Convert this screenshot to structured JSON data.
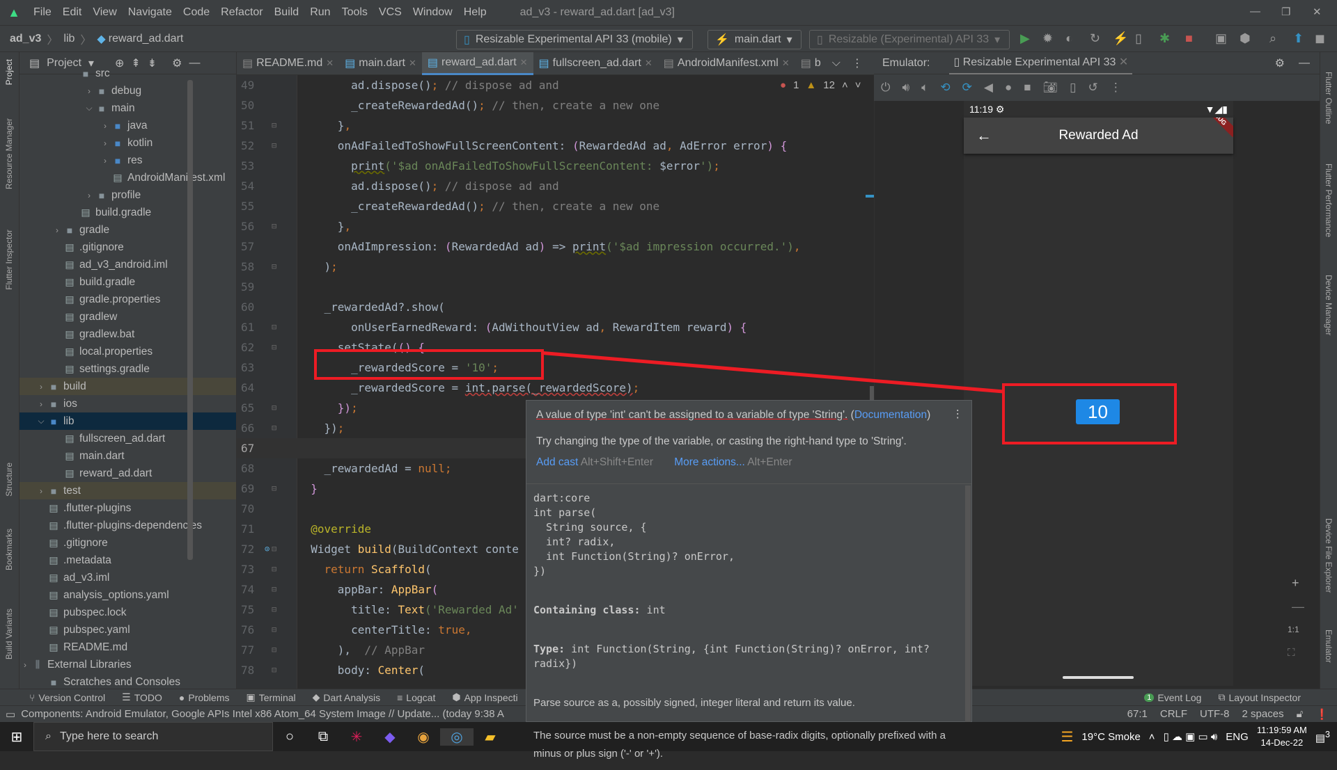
{
  "window": {
    "title": "ad_v3 - reward_ad.dart [ad_v3]",
    "menu": [
      "File",
      "Edit",
      "View",
      "Navigate",
      "Code",
      "Refactor",
      "Build",
      "Run",
      "Tools",
      "VCS",
      "Window",
      "Help"
    ]
  },
  "nav": {
    "breadcrumb": [
      "ad_v3",
      "lib",
      "reward_ad.dart"
    ],
    "device_combo": "Resizable Experimental API 33 (mobile)",
    "run_config": "main.dart",
    "target_combo": "Resizable (Experimental) API 33"
  },
  "left_strip": [
    "Project",
    "Resource Manager",
    "Flutter Inspector",
    "Structure",
    "Bookmarks",
    "Build Variants"
  ],
  "right_strip": [
    "Flutter Outline",
    "Flutter Performance",
    "Device Manager",
    "Device File Explorer",
    "Emulator"
  ],
  "project": {
    "title": "Project",
    "tree": [
      {
        "label": "src",
        "level": 3,
        "kind": "folder",
        "arrow": ""
      },
      {
        "label": "debug",
        "level": 4,
        "kind": "folder",
        "arrow": "collapsed"
      },
      {
        "label": "main",
        "level": 4,
        "kind": "folder",
        "arrow": "expanded"
      },
      {
        "label": "java",
        "level": 5,
        "kind": "folder",
        "arrow": "collapsed"
      },
      {
        "label": "kotlin",
        "level": 5,
        "kind": "folder",
        "arrow": "collapsed"
      },
      {
        "label": "res",
        "level": 5,
        "kind": "folder",
        "arrow": "collapsed"
      },
      {
        "label": "AndroidManifest.xml",
        "level": 5,
        "kind": "file",
        "arrow": ""
      },
      {
        "label": "profile",
        "level": 4,
        "kind": "folder",
        "arrow": "collapsed"
      },
      {
        "label": "build.gradle",
        "level": 3,
        "kind": "file",
        "arrow": ""
      },
      {
        "label": "gradle",
        "level": 2,
        "kind": "folder",
        "arrow": "collapsed"
      },
      {
        "label": ".gitignore",
        "level": 2,
        "kind": "file",
        "arrow": ""
      },
      {
        "label": "ad_v3_android.iml",
        "level": 2,
        "kind": "file",
        "arrow": ""
      },
      {
        "label": "build.gradle",
        "level": 2,
        "kind": "file",
        "arrow": ""
      },
      {
        "label": "gradle.properties",
        "level": 2,
        "kind": "file",
        "arrow": ""
      },
      {
        "label": "gradlew",
        "level": 2,
        "kind": "file",
        "arrow": ""
      },
      {
        "label": "gradlew.bat",
        "level": 2,
        "kind": "file",
        "arrow": ""
      },
      {
        "label": "local.properties",
        "level": 2,
        "kind": "file",
        "arrow": ""
      },
      {
        "label": "settings.gradle",
        "level": 2,
        "kind": "file",
        "arrow": ""
      },
      {
        "label": "build",
        "level": 1,
        "kind": "folder",
        "arrow": "collapsed",
        "state": "ex"
      },
      {
        "label": "ios",
        "level": 1,
        "kind": "folder",
        "arrow": "collapsed"
      },
      {
        "label": "lib",
        "level": 1,
        "kind": "folder",
        "arrow": "expanded",
        "state": "sel"
      },
      {
        "label": "fullscreen_ad.dart",
        "level": 2,
        "kind": "file",
        "arrow": ""
      },
      {
        "label": "main.dart",
        "level": 2,
        "kind": "file",
        "arrow": ""
      },
      {
        "label": "reward_ad.dart",
        "level": 2,
        "kind": "file",
        "arrow": ""
      },
      {
        "label": "test",
        "level": 1,
        "kind": "folder",
        "arrow": "collapsed",
        "state": "ex"
      },
      {
        "label": ".flutter-plugins",
        "level": 1,
        "kind": "file",
        "arrow": ""
      },
      {
        "label": ".flutter-plugins-dependencies",
        "level": 1,
        "kind": "file",
        "arrow": ""
      },
      {
        "label": ".gitignore",
        "level": 1,
        "kind": "file",
        "arrow": ""
      },
      {
        "label": ".metadata",
        "level": 1,
        "kind": "file",
        "arrow": ""
      },
      {
        "label": "ad_v3.iml",
        "level": 1,
        "kind": "file",
        "arrow": ""
      },
      {
        "label": "analysis_options.yaml",
        "level": 1,
        "kind": "file",
        "arrow": ""
      },
      {
        "label": "pubspec.lock",
        "level": 1,
        "kind": "file",
        "arrow": ""
      },
      {
        "label": "pubspec.yaml",
        "level": 1,
        "kind": "file",
        "arrow": ""
      },
      {
        "label": "README.md",
        "level": 1,
        "kind": "file",
        "arrow": ""
      },
      {
        "label": "External Libraries",
        "level": 0,
        "kind": "lib",
        "arrow": "collapsed"
      },
      {
        "label": "Scratches and Consoles",
        "level": 1,
        "kind": "folder",
        "arrow": ""
      }
    ]
  },
  "tabs": [
    {
      "label": "README.md"
    },
    {
      "label": "main.dart"
    },
    {
      "label": "reward_ad.dart",
      "active": true
    },
    {
      "label": "fullscreen_ad.dart"
    },
    {
      "label": "AndroidManifest.xml"
    },
    {
      "label": "b"
    }
  ],
  "inspections": {
    "errors": "1",
    "warnings": "12"
  },
  "code": {
    "current_line": 67,
    "lines": [
      {
        "n": 49,
        "t": [
          [
            "        ad.dispose()",
            "d"
          ],
          [
            ";",
            "k"
          ],
          [
            " // dispose ad and",
            "c"
          ]
        ]
      },
      {
        "n": 50,
        "t": [
          [
            "        _createRewardedAd()",
            "d"
          ],
          [
            ";",
            "k"
          ],
          [
            " // then, create a new one",
            "c"
          ]
        ]
      },
      {
        "n": 51,
        "t": [
          [
            "      }",
            "d"
          ],
          [
            ",",
            "k"
          ]
        ]
      },
      {
        "n": 52,
        "t": [
          [
            "      onAdFailedToShowFullScreenContent: ",
            "d"
          ],
          [
            "(",
            "p"
          ],
          [
            "RewardedAd ad",
            "d"
          ],
          [
            ", ",
            "k"
          ],
          [
            "AdError error",
            "d"
          ],
          [
            ")",
            "p"
          ],
          [
            " {",
            "p"
          ]
        ]
      },
      {
        "n": 53,
        "t": [
          [
            "        ",
            "d"
          ],
          [
            "print",
            "u"
          ],
          [
            "('$ad ",
            "s"
          ],
          [
            "onAdFailedToShowFullScreenContent: ",
            "s"
          ],
          [
            "$error",
            "d"
          ],
          [
            "')",
            "s"
          ],
          [
            ";",
            "k"
          ]
        ]
      },
      {
        "n": 54,
        "t": [
          [
            "        ad.dispose()",
            "d"
          ],
          [
            ";",
            "k"
          ],
          [
            " // dispose ad and",
            "c"
          ]
        ]
      },
      {
        "n": 55,
        "t": [
          [
            "        _createRewardedAd()",
            "d"
          ],
          [
            ";",
            "k"
          ],
          [
            " // then, create a new one",
            "c"
          ]
        ]
      },
      {
        "n": 56,
        "t": [
          [
            "      }",
            "d"
          ],
          [
            ",",
            "k"
          ]
        ]
      },
      {
        "n": 57,
        "t": [
          [
            "      onAdImpression: ",
            "d"
          ],
          [
            "(",
            "p"
          ],
          [
            "RewardedAd ad",
            "d"
          ],
          [
            ")",
            "p"
          ],
          [
            " => ",
            "d"
          ],
          [
            "print",
            "u"
          ],
          [
            "('$ad impression occurred.')",
            "s"
          ],
          [
            ",",
            "k"
          ]
        ]
      },
      {
        "n": 58,
        "t": [
          [
            "    )",
            "d"
          ],
          [
            ";",
            "k"
          ]
        ]
      },
      {
        "n": 59,
        "t": []
      },
      {
        "n": 60,
        "t": [
          [
            "    _rewardedAd?.show(",
            "d"
          ]
        ]
      },
      {
        "n": 61,
        "t": [
          [
            "        onUserEarnedReward: ",
            "d"
          ],
          [
            "(",
            "p"
          ],
          [
            "AdWithoutView ad",
            "d"
          ],
          [
            ", ",
            "k"
          ],
          [
            "RewardItem reward",
            "d"
          ],
          [
            ")",
            "p"
          ],
          [
            " {",
            "p"
          ]
        ]
      },
      {
        "n": 62,
        "t": [
          [
            "      setState(",
            "d"
          ],
          [
            "() {",
            "p"
          ]
        ]
      },
      {
        "n": 63,
        "t": [
          [
            "        _rewardedScore = ",
            "d"
          ],
          [
            "'10'",
            "s"
          ],
          [
            ";",
            "k"
          ]
        ]
      },
      {
        "n": 64,
        "t": [
          [
            "        _rewardedScore = ",
            "d"
          ],
          [
            "int.parse(_rewardedScore)",
            "e"
          ],
          [
            ";",
            "k"
          ]
        ]
      },
      {
        "n": 65,
        "t": [
          [
            "      })",
            "p"
          ],
          [
            ";",
            "k"
          ]
        ]
      },
      {
        "n": 66,
        "t": [
          [
            "    })",
            "d"
          ],
          [
            ";",
            "k"
          ]
        ]
      },
      {
        "n": 67,
        "t": []
      },
      {
        "n": 68,
        "t": [
          [
            "    _rewardedAd = ",
            "d"
          ],
          [
            "null",
            "k"
          ],
          [
            ";",
            "k"
          ]
        ]
      },
      {
        "n": 69,
        "t": [
          [
            "  }",
            "p"
          ]
        ]
      },
      {
        "n": 70,
        "t": []
      },
      {
        "n": 71,
        "t": [
          [
            "  @override",
            "a"
          ]
        ]
      },
      {
        "n": 72,
        "t": [
          [
            "  Widget ",
            "d"
          ],
          [
            "build",
            "f"
          ],
          [
            "(BuildContext conte",
            "d"
          ]
        ]
      },
      {
        "n": 73,
        "t": [
          [
            "    return ",
            "k"
          ],
          [
            "Scaffold",
            "f"
          ],
          [
            "(",
            "d"
          ]
        ]
      },
      {
        "n": 74,
        "t": [
          [
            "      appBar: ",
            "d"
          ],
          [
            "AppBar",
            "f"
          ],
          [
            "(",
            "p"
          ]
        ]
      },
      {
        "n": 75,
        "t": [
          [
            "        title: ",
            "d"
          ],
          [
            "Text",
            "f"
          ],
          [
            "('Rewarded Ad'",
            "s"
          ]
        ]
      },
      {
        "n": 76,
        "t": [
          [
            "        centerTitle: ",
            "d"
          ],
          [
            "true",
            "k"
          ],
          [
            ",",
            "k"
          ]
        ]
      },
      {
        "n": 77,
        "t": [
          [
            "      ),  ",
            "d"
          ],
          [
            "// AppBar",
            "c"
          ]
        ]
      },
      {
        "n": 78,
        "t": [
          [
            "      body: ",
            "d"
          ],
          [
            "Center",
            "f"
          ],
          [
            "(",
            "d"
          ]
        ]
      }
    ]
  },
  "popup": {
    "error": "A value of type 'int' can't be assigned to a variable of type 'String'.",
    "doc_link": "Documentation",
    "hint": "Try changing the type of the variable, or casting the right-hand type to 'String'.",
    "action1": "Add cast",
    "action1_sc": "Alt+Shift+Enter",
    "action2": "More actions...",
    "action2_sc": "Alt+Enter",
    "signature": "dart:core\nint parse(\n  String source, {\n  int? radix,\n  int Function(String)? onError,\n})",
    "containing_label": "Containing class:",
    "containing": " int",
    "type_label": "Type:",
    "type": " int Function(String, {int Function(String)? onError, int?\nradix})",
    "desc1": "Parse source as a, possibly signed, integer literal and return its value.",
    "desc2": "The source must be a non-empty sequence of base-radix digits, optionally prefixed with a minus or plus sign ('-' or '+')."
  },
  "emulator": {
    "label": "Emulator:",
    "tab": "Resizable Experimental API 33",
    "phone_time": "11:19",
    "appbar_title": "Rewarded Ad",
    "debug_banner": "DEBUG",
    "score": "10"
  },
  "accent": {
    "annotation": "#ed1c24",
    "score_badge": "#1e88e5"
  },
  "toolwindows": [
    {
      "icon": "version-control",
      "label": "Version Control"
    },
    {
      "icon": "todo",
      "label": "TODO"
    },
    {
      "icon": "problems",
      "label": "Problems"
    },
    {
      "icon": "terminal",
      "label": "Terminal"
    },
    {
      "icon": "dart-analysis",
      "label": "Dart Analysis"
    },
    {
      "icon": "logcat",
      "label": "Logcat"
    },
    {
      "icon": "app-inspection",
      "label": "App Inspecti"
    }
  ],
  "toolwindows_right": {
    "event_log": "Event Log",
    "event_count": "1",
    "layout_inspector": "Layout Inspector"
  },
  "status": {
    "message": "Components: Android Emulator, Google APIs Intel x86 Atom_64 System Image // Update... (today 9:38 A",
    "position": "67:1",
    "line_sep": "CRLF",
    "encoding": "UTF-8",
    "indent": "2 spaces"
  },
  "taskbar": {
    "search_placeholder": "Type here to search",
    "weather": "19°C  Smoke",
    "lang": "ENG",
    "time": "11:19:59 AM",
    "date": "14-Dec-22",
    "notif": "3"
  }
}
